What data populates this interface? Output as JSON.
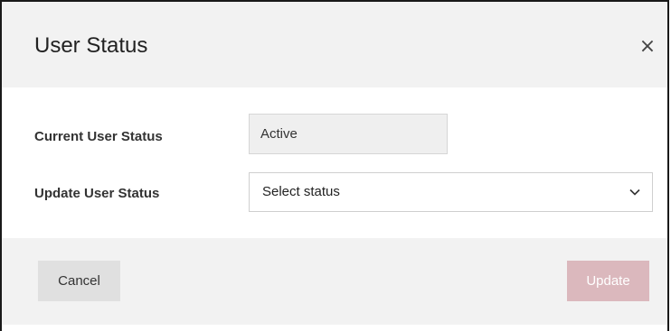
{
  "dialog": {
    "title": "User Status",
    "close_glyph": "×",
    "close_icon": "close-icon"
  },
  "form": {
    "current_status_label": "Current User Status",
    "current_status_value": "Active",
    "update_status_label": "Update User Status",
    "update_status_selected": "Select status",
    "dropdown_icon": "chevron-down-icon"
  },
  "footer": {
    "cancel_label": "Cancel",
    "update_label": "Update",
    "update_disabled": true
  },
  "colors": {
    "header_bg": "#f2f2f2",
    "readonly_bg": "#efefef",
    "cancel_bg": "#e0e0e0",
    "update_disabled_bg": "#dbb8bd"
  }
}
